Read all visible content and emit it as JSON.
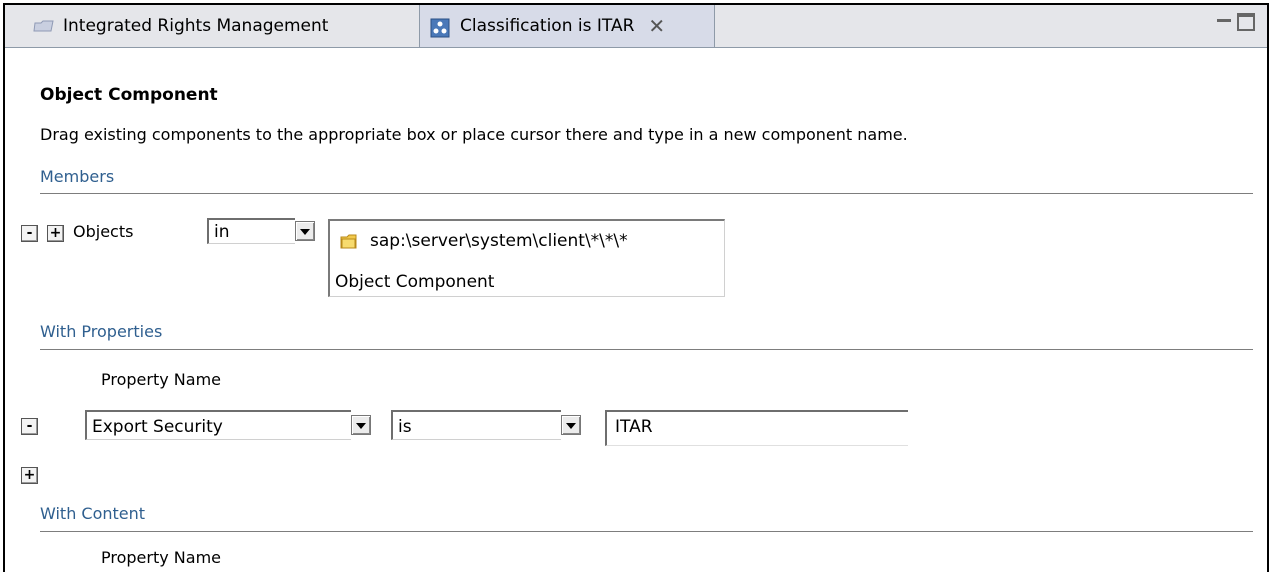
{
  "tabs": [
    {
      "label": "Integrated Rights Management",
      "icon": "folder-icon"
    },
    {
      "label": "Classification is ITAR",
      "icon": "classification-icon",
      "active": true
    }
  ],
  "window_controls": {
    "minimize_icon": "minimize-icon",
    "maximize_icon": "maximize-icon"
  },
  "editor": {
    "title": "Object Component",
    "description": "Drag existing components to the appropriate box or place cursor there and type in a new component name.",
    "members": {
      "heading": "Members",
      "remove_label": "-",
      "add_label": "+",
      "objects_label": "Objects",
      "operator_value": "in",
      "object_path": "sap:\\server\\system\\client\\*\\*\\*",
      "object_caption": "Object Component"
    },
    "with_properties": {
      "heading": "With Properties",
      "column_header": "Property Name",
      "remove_label": "-",
      "add_label": "+",
      "row": {
        "property": "Export Security",
        "operator": "is",
        "value": "ITAR"
      }
    },
    "with_content": {
      "heading": "With Content",
      "column_header": "Property Name"
    }
  },
  "colors": {
    "section_heading": "#2f5f8f",
    "tab_active_bg": "#d7dbe8",
    "tabbar_bg": "#e5e6ea"
  }
}
